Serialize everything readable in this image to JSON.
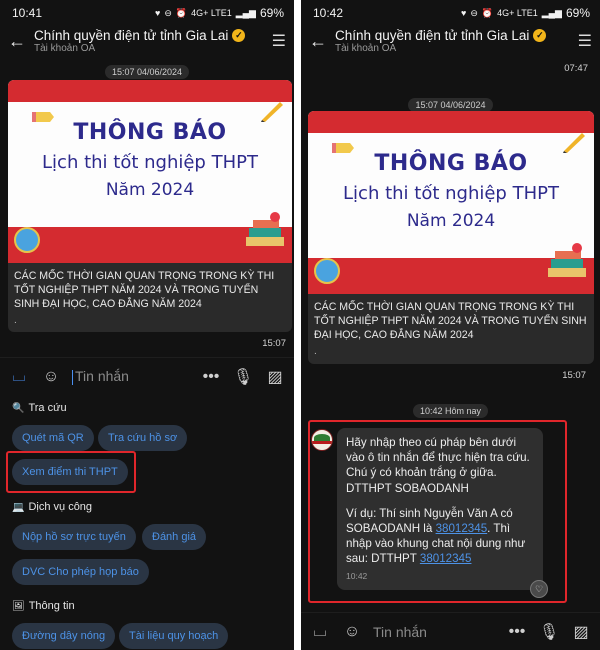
{
  "left": {
    "status": {
      "time": "10:41",
      "battery": "69%",
      "net": "4G+ LTE1"
    },
    "header": {
      "title": "Chính quyền điện tử tỉnh Gia Lai",
      "subtitle": "Tài khoản OA"
    },
    "date_pill": "15:07 04/06/2024",
    "banner": {
      "line1": "THÔNG BÁO",
      "line2": "Lịch thi tốt nghiệp THPT",
      "line3": "Năm 2024"
    },
    "caption": "CÁC MỐC THỜI GIAN QUAN TRỌNG TRONG KỲ THI TỐT NGHIỆP THPT NĂM 2024 VÀ TRONG TUYỂN SINH ĐẠI HỌC, CAO ĐẲNG NĂM 2024",
    "caption_dot": ".",
    "msg_time": "15:07",
    "input_placeholder": "Tin nhắn",
    "sections": {
      "tra_cuu": {
        "label": "Tra cứu",
        "buttons": [
          "Quét mã QR",
          "Tra cứu hồ sơ",
          "Xem điểm thi THPT"
        ]
      },
      "dich_vu": {
        "label": "Dịch vụ công",
        "buttons": [
          "Nộp hồ sơ trực tuyến",
          "Đánh giá",
          "DVC Cho phép họp báo"
        ]
      },
      "thong_tin": {
        "label": "Thông tin",
        "buttons": [
          "Đường dây nóng",
          "Tài liệu quy hoạch"
        ]
      }
    }
  },
  "right": {
    "status": {
      "time": "10:42",
      "battery": "69%",
      "net": "4G+ LTE1"
    },
    "header": {
      "title": "Chính quyền điện tử tỉnh Gia Lai",
      "subtitle": "Tài khoản OA"
    },
    "top_time": "07:47",
    "date_pill": "15:07 04/06/2024",
    "banner": {
      "line1": "THÔNG BÁO",
      "line2": "Lịch thi tốt nghiệp THPT",
      "line3": "Năm 2024"
    },
    "caption": "CÁC MỐC THỜI GIAN QUAN TRỌNG TRONG KỲ THI TỐT NGHIỆP THPT NĂM 2024 VÀ TRONG TUYỂN SINH ĐẠI HỌC, CAO ĐẲNG NĂM 2024",
    "caption_dot": ".",
    "msg_time": "15:07",
    "today_pill": "10:42 Hôm nay",
    "reply": {
      "line1": "Hãy nhập theo cú pháp bên dưới vào ô tin nhắn để thực hiện tra cứu. Chú ý có khoản trắng ở giữa.",
      "line2": "DTTHPT SOBAODANH",
      "example_a": "Ví dụ: Thí sinh Nguyễn Văn A có SOBAODANH là ",
      "example_link": "38012345",
      "example_b": ". Thì nhập vào khung chat nội dung như sau: DTTHPT ",
      "example_link2": "38012345",
      "time": "10:42"
    },
    "input_placeholder": "Tin nhắn"
  },
  "colors": {
    "accent": "#4d92e6",
    "highlight": "#e0262b",
    "background": "#121212"
  }
}
